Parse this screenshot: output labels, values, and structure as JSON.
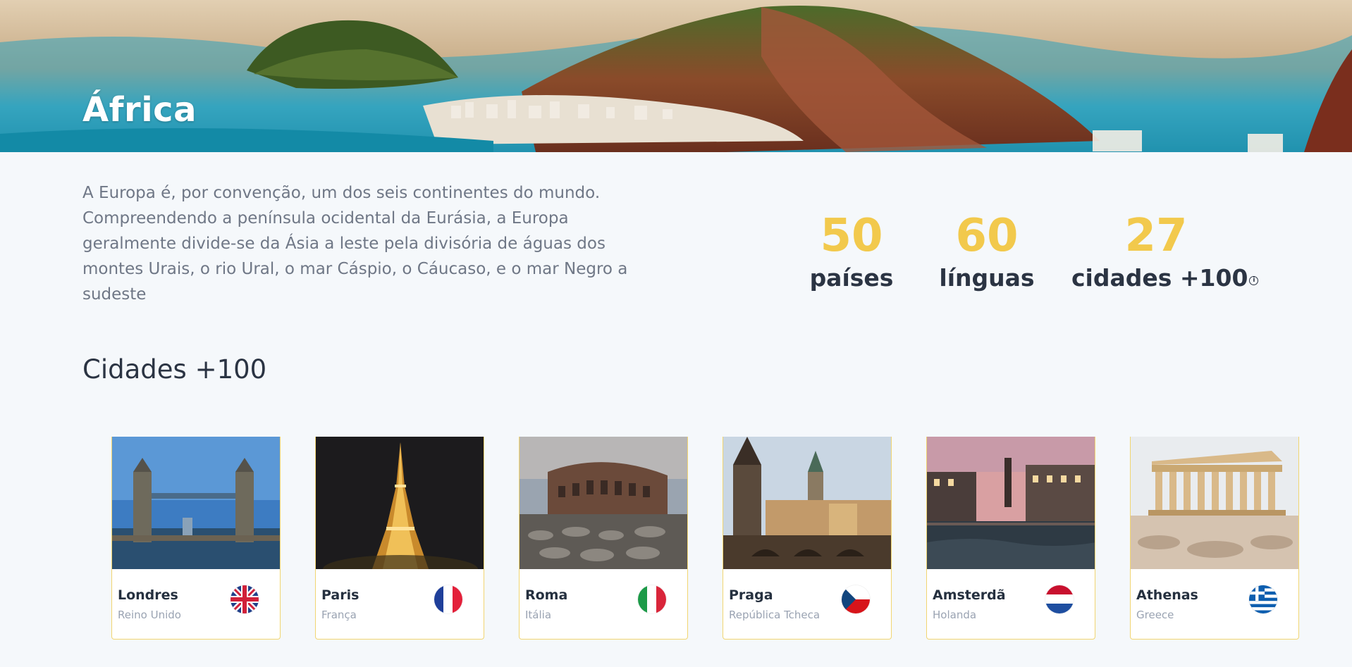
{
  "hero": {
    "title": "África"
  },
  "intro": {
    "description": "A Europa é, por convenção, um dos seis continentes do mundo. Compreendendo a península ocidental da Eurásia, a Europa geralmente divide-se da Ásia a leste pela divisória de águas dos montes Urais, o rio Ural, o mar Cáspio, o Cáucaso, e o mar Negro a sudeste"
  },
  "stats": [
    {
      "number": "50",
      "label": "países"
    },
    {
      "number": "60",
      "label": "línguas"
    },
    {
      "number": "27",
      "label": "cidades +100",
      "icon": "info-icon"
    }
  ],
  "section": {
    "title": "Cidades +100"
  },
  "cities": [
    {
      "name": "Londres",
      "country": "Reino Unido",
      "flag": "uk-flag-icon"
    },
    {
      "name": "Paris",
      "country": "França",
      "flag": "france-flag-icon"
    },
    {
      "name": "Roma",
      "country": "Itália",
      "flag": "italy-flag-icon"
    },
    {
      "name": "Praga",
      "country": "República Tcheca",
      "flag": "czech-flag-icon"
    },
    {
      "name": "Amsterdã",
      "country": "Holanda",
      "flag": "netherlands-flag-icon"
    },
    {
      "name": "Athenas",
      "country": "Greece",
      "flag": "greece-flag-icon"
    }
  ],
  "colors": {
    "accent": "#f2c94c",
    "background": "#f5f8fb",
    "heading": "#2b3443",
    "body_text": "#6f7786",
    "card_border": "#f1d571"
  }
}
